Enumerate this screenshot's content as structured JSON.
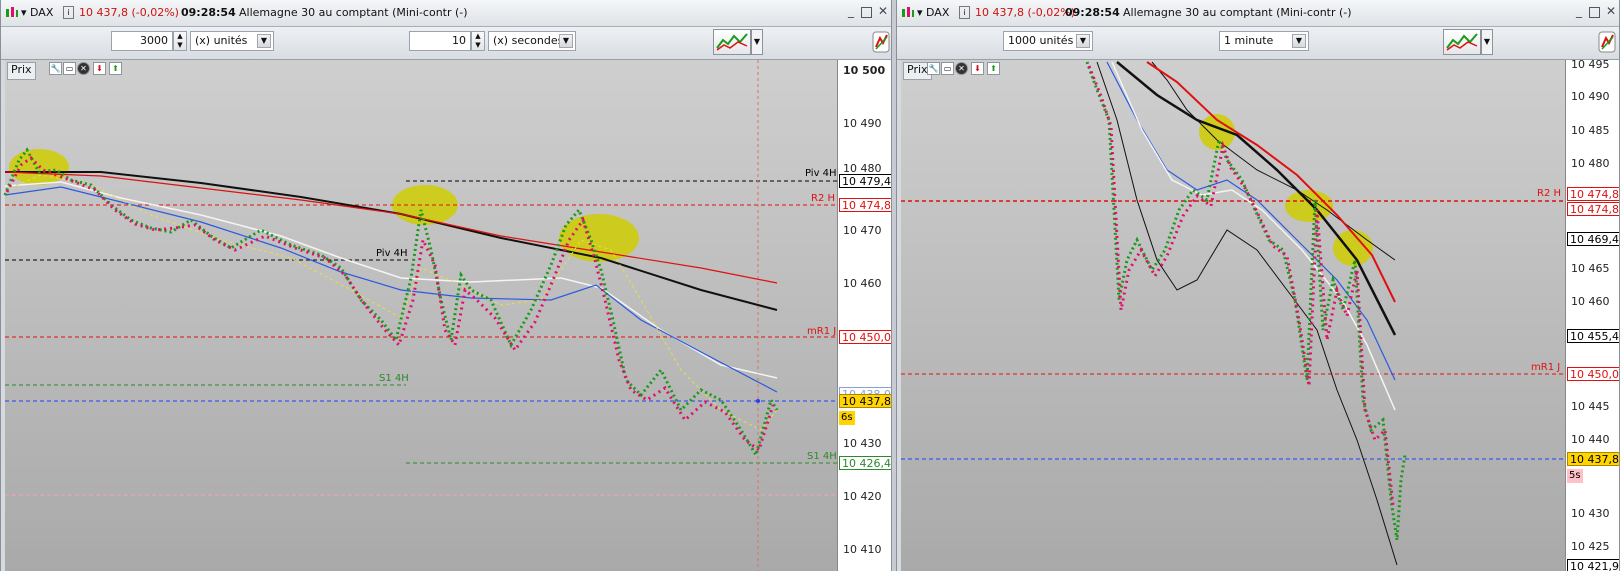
{
  "left": {
    "title": {
      "instrument": "DAX",
      "price": "10 437,8 (-0,02%)",
      "time": "09:28:54",
      "desc": "Allemagne 30 au comptant (Mini-contr (-)"
    },
    "toolbar": {
      "qty": "3000",
      "qty_unit": "(x) unités",
      "period": "10",
      "period_unit": "(x) secondes"
    },
    "prix_label": "Prix",
    "axis_ticks": [
      "10 500",
      "10 490",
      "10 480",
      "10 470",
      "10 460",
      "10 450",
      "10 440",
      "10 430",
      "10 420",
      "10 410"
    ],
    "levels": [
      {
        "label": "Piv 4H",
        "value": "10 479,4",
        "color": "#000000"
      },
      {
        "label": "R2 H",
        "value": "10 474,8",
        "color": "#e01010"
      },
      {
        "label": "Piv 4H",
        "value": "",
        "color": "#000000"
      },
      {
        "label": "mR1 J",
        "value": "10 450,0",
        "color": "#e01010"
      },
      {
        "label": "S1 4H",
        "value": "10 438,0",
        "color": "#2a8a2a"
      },
      {
        "label": "",
        "value": "10 437,8",
        "color": "#2040ff"
      },
      {
        "label": "S1 4H",
        "value": "10 426,4",
        "color": "#2a8a2a"
      }
    ],
    "countdown": "6s"
  },
  "right": {
    "title": {
      "instrument": "DAX",
      "price": "10 437,8 (-0,02%)",
      "time": "09:28:54",
      "desc": "Allemagne 30 au comptant (Mini-contr (-)"
    },
    "toolbar": {
      "qty_unit": "1000 unités",
      "period": "1 minute"
    },
    "prix_label": "Prix",
    "axis_ticks": [
      "10 495",
      "10 490",
      "10 485",
      "10 480",
      "10 475",
      "10 470",
      "10 465",
      "10 460",
      "10 455",
      "10 450",
      "10 445",
      "10 440",
      "10 435",
      "10 430",
      "10 425",
      "10 421,9"
    ],
    "levels": [
      {
        "label": "R2 H",
        "value": "10 474,8",
        "color": "#e01010"
      },
      {
        "label": "",
        "value": "10 474,8",
        "color": "#e01010"
      },
      {
        "label": "",
        "value": "10 469,4",
        "color": "#000000"
      },
      {
        "label": "",
        "value": "10 455,4",
        "color": "#000000"
      },
      {
        "label": "mR1 J",
        "value": "10 450,0",
        "color": "#e01010"
      },
      {
        "label": "",
        "value": "10 437,8",
        "color": "#2040ff"
      }
    ],
    "countdown": "5s"
  },
  "colors": {
    "up": "#1a9a1a",
    "down": "#e0106a",
    "ma_red": "#e01010",
    "ma_black": "#111111",
    "ma_blue": "#2a5ae0",
    "ma_white": "#f4f4f4",
    "highlight": "#cfcc00",
    "price_tag": "#ffd400"
  }
}
